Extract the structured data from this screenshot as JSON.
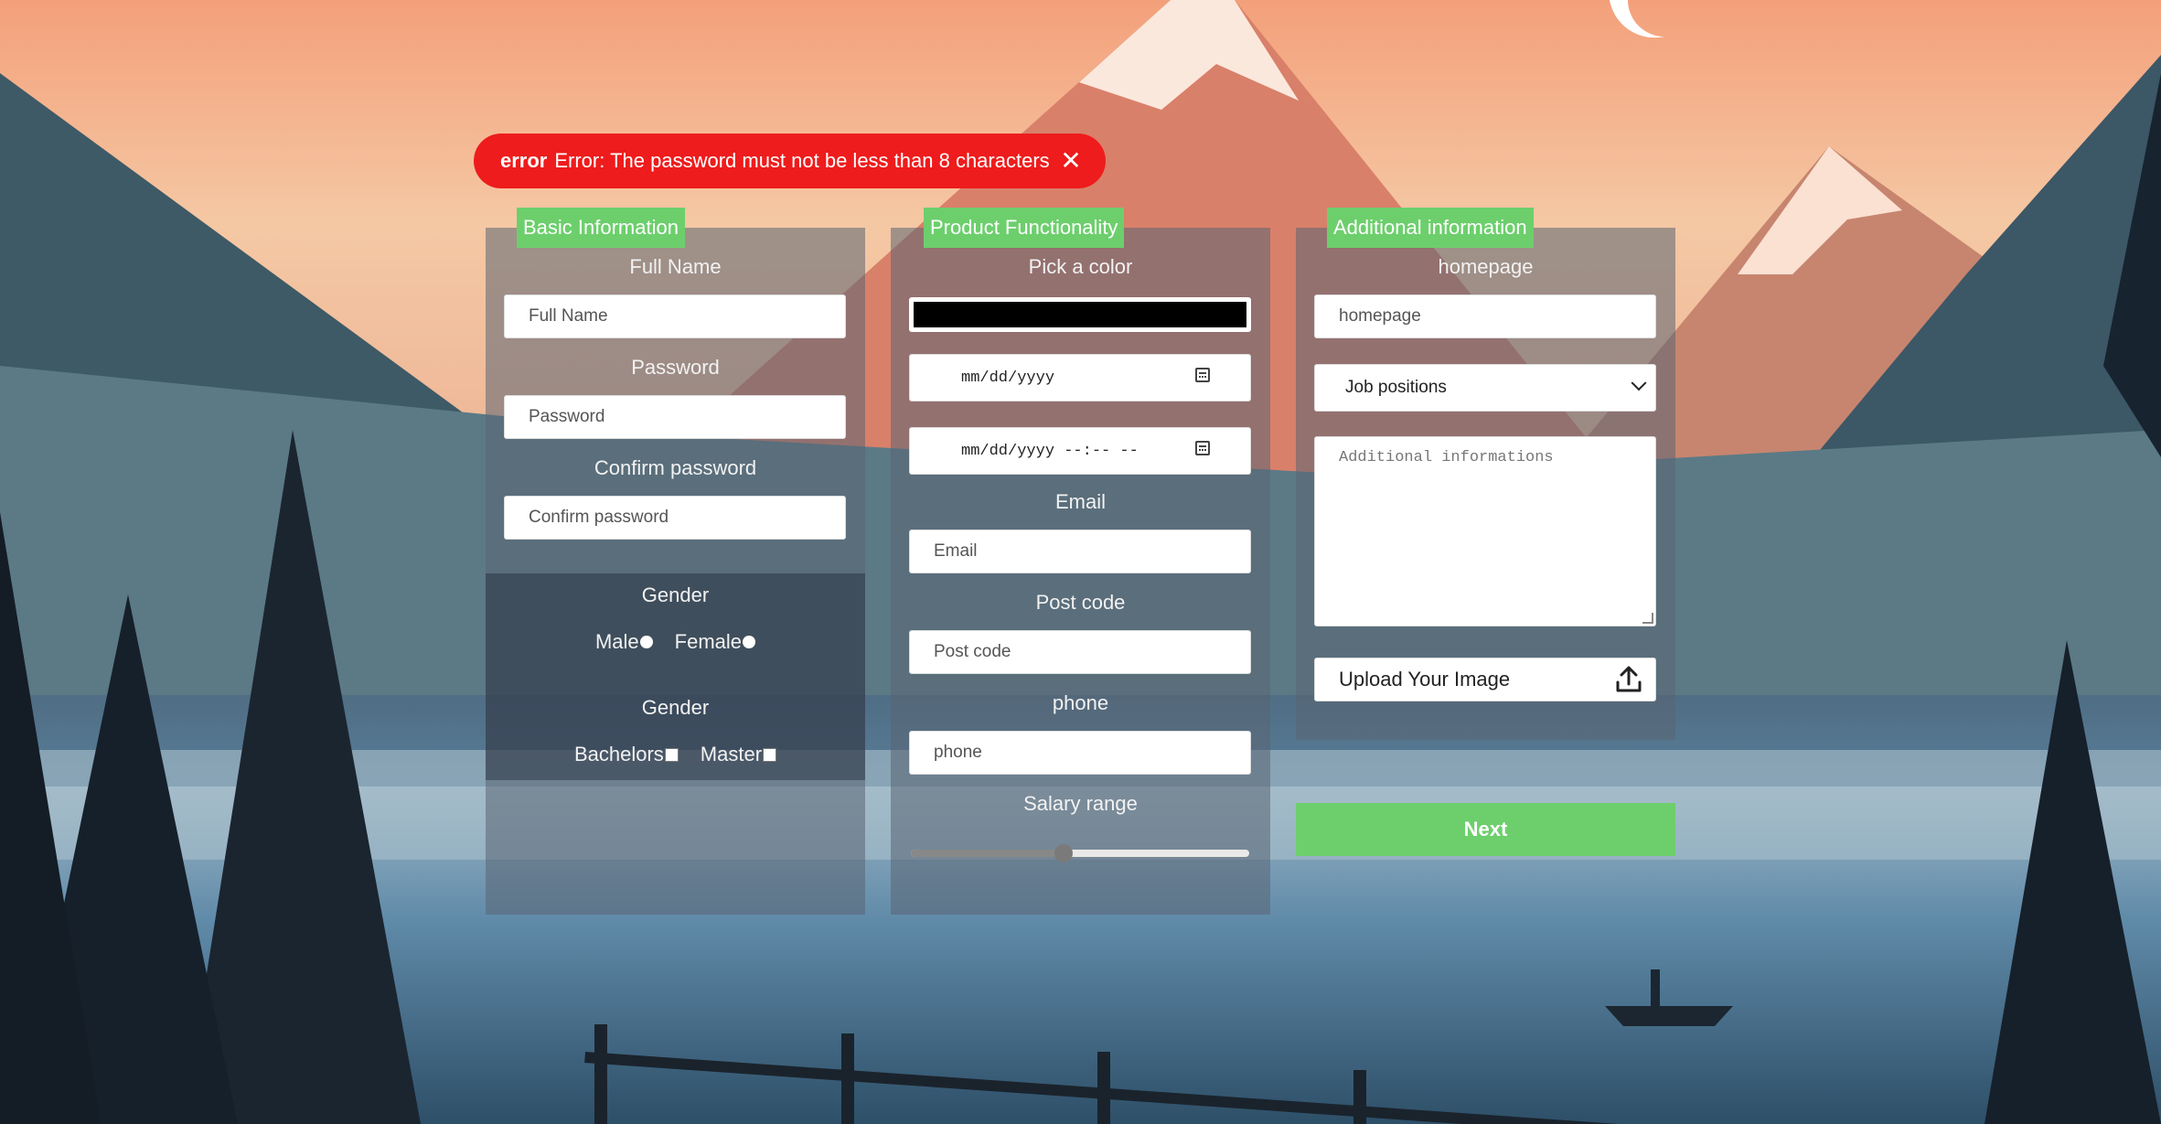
{
  "toast": {
    "tag": "error",
    "message": "Error: The password must not be less than 8 characters",
    "close_glyph": "✕",
    "color": "#ee1c1c"
  },
  "basic": {
    "tab": "Basic Information",
    "full_name_label": "Full Name",
    "full_name_placeholder": "Full Name",
    "password_label": "Password",
    "password_placeholder": "Password",
    "confirm_label": "Confirm password",
    "confirm_placeholder": "Confirm password",
    "gender_label": "Gender",
    "male_label": "Male",
    "female_label": "Female",
    "gender2_label": "Gender",
    "bachelors_label": "Bachelors",
    "master_label": "Master"
  },
  "product": {
    "tab": "Product Functionality",
    "color_label": "Pick a color",
    "color_value": "#000000",
    "date_value": "mm/dd/yyyy",
    "datetime_value": "mm/dd/yyyy --:-- --",
    "email_label": "Email",
    "email_placeholder": "Email",
    "postcode_label": "Post code",
    "postcode_placeholder": "Post code",
    "phone_label": "phone",
    "phone_placeholder": "phone",
    "salary_label": "Salary range",
    "salary_fraction": 0.45
  },
  "additional": {
    "tab": "Additional information",
    "homepage_label": "homepage",
    "homepage_placeholder": "homepage",
    "job_select": "Job positions",
    "textarea_placeholder": "Additional informations",
    "upload_label": "Upload Your Image",
    "upload_icon": "upload-icon"
  },
  "next_button": "Next",
  "accent": "#6ccf6c"
}
